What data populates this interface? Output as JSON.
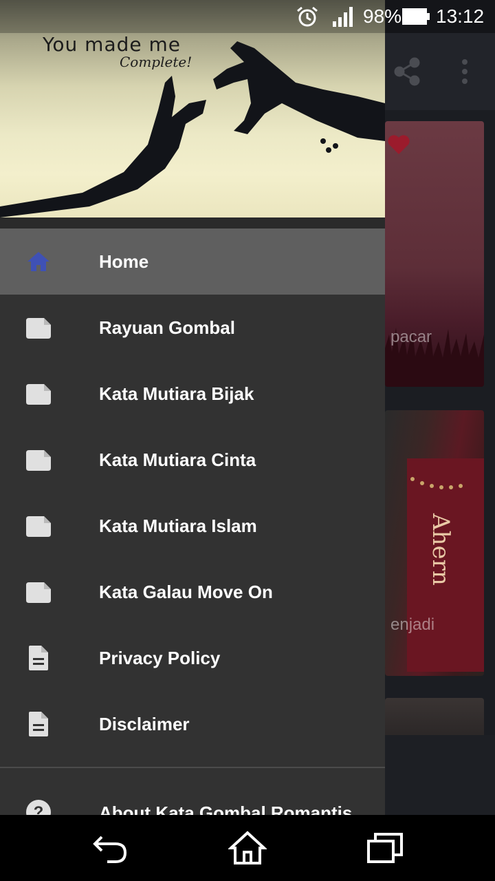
{
  "status_bar": {
    "battery_percent": "98%",
    "time": "13:12",
    "icons": [
      "alarm-icon",
      "signal-icon",
      "battery-icon"
    ]
  },
  "background_app": {
    "card1_caption": "pacar",
    "card2_caption": "enjadi",
    "toolbar_icons": [
      "share-icon",
      "more-vert-icon"
    ]
  },
  "drawer": {
    "header_image_text": {
      "line1": "You made me",
      "line2": "Complete!"
    },
    "menu_items": [
      {
        "label": "Home",
        "icon": "home-icon",
        "active": true
      },
      {
        "label": "Rayuan Gombal",
        "icon": "note-icon"
      },
      {
        "label": "Kata Mutiara Bijak",
        "icon": "note-icon"
      },
      {
        "label": "Kata Mutiara Cinta",
        "icon": "note-icon"
      },
      {
        "label": "Kata Mutiara Islam",
        "icon": "note-icon"
      },
      {
        "label": "Kata Galau Move On",
        "icon": "note-icon"
      },
      {
        "label": "Privacy Policy",
        "icon": "document-icon"
      },
      {
        "label": "Disclaimer",
        "icon": "document-icon"
      }
    ],
    "about_item": {
      "label": "About Kata Gombal Romantis",
      "icon": "help-icon"
    }
  },
  "nav_bar": {
    "buttons": [
      "back-icon",
      "home-icon",
      "recents-icon"
    ]
  },
  "colors": {
    "accent": "#3f51b5",
    "drawer_bg": "#323232",
    "active_item_bg": "#5f5f5f",
    "icon_gray": "#e0e0e0"
  }
}
